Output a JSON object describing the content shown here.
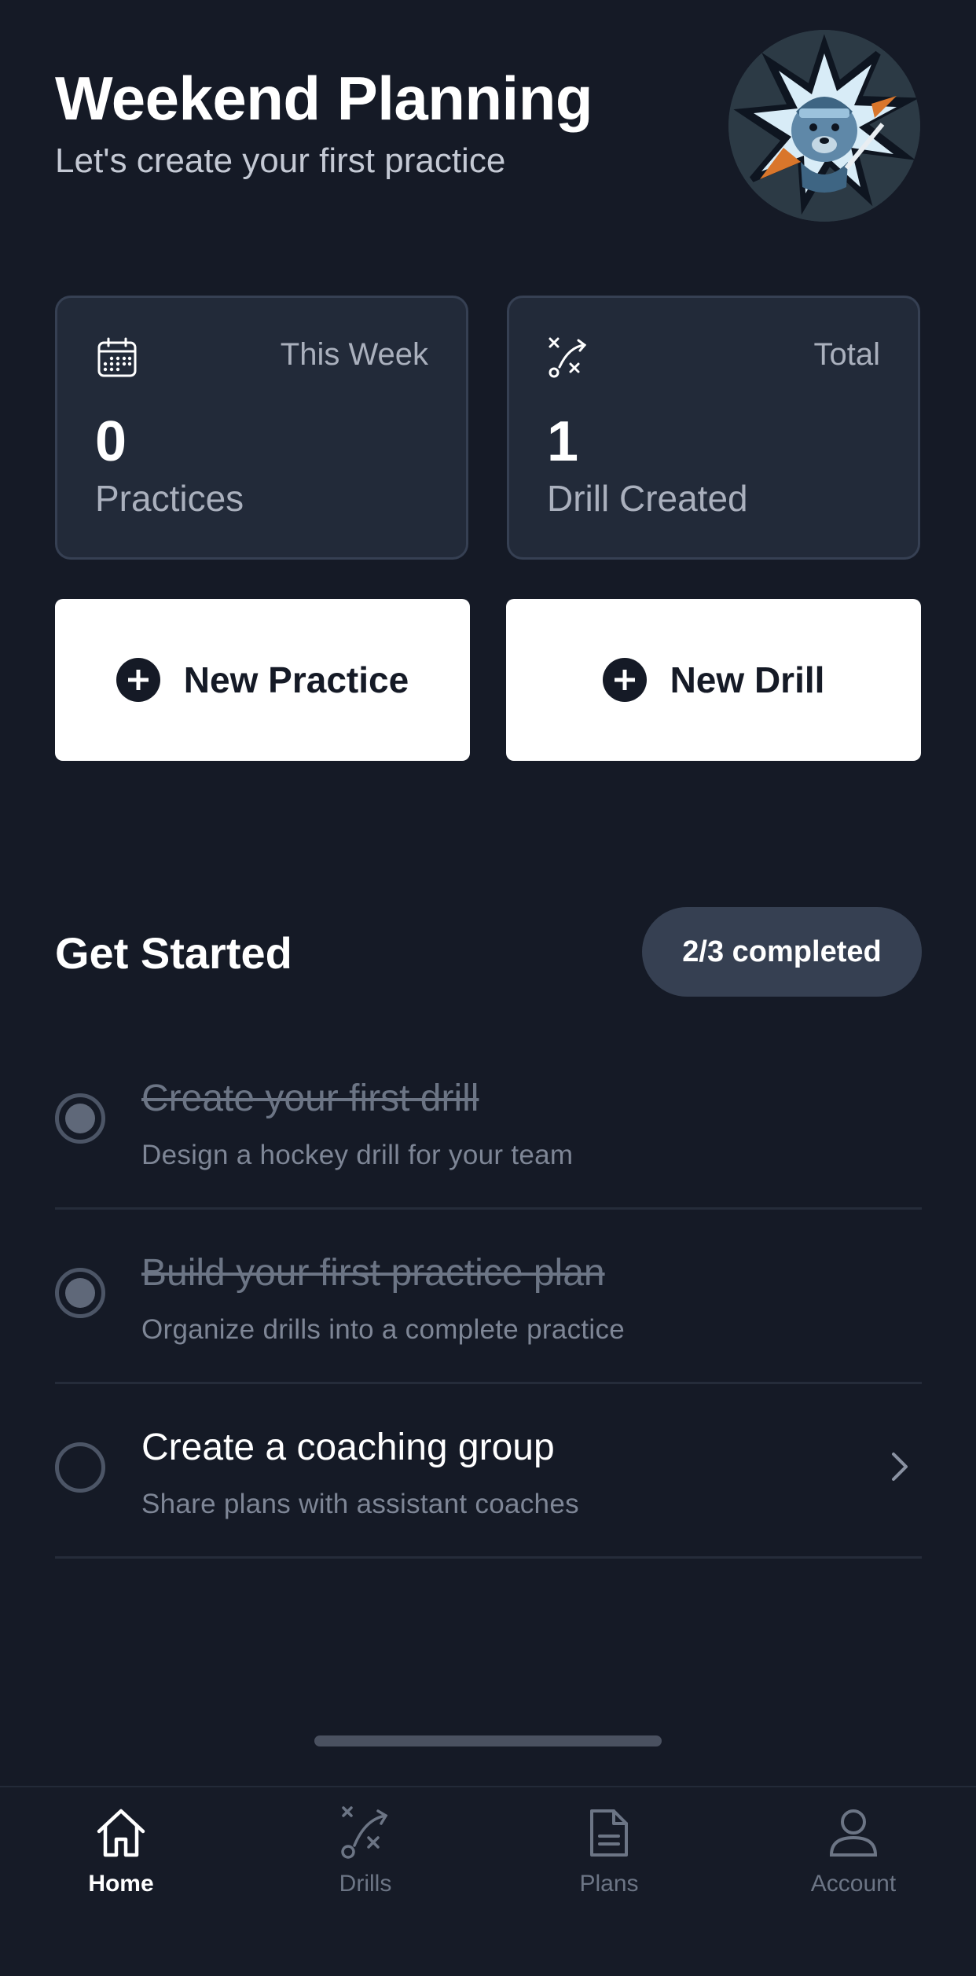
{
  "header": {
    "title": "Weekend Planning",
    "subtitle": "Let's create your first practice",
    "avatar_icon": "bear-team-logo-icon"
  },
  "stats": [
    {
      "icon": "calendar-icon",
      "period": "This Week",
      "value": "0",
      "label": "Practices"
    },
    {
      "icon": "drill-play-icon",
      "period": "Total",
      "value": "1",
      "label": "Drill Created"
    }
  ],
  "actions": {
    "new_practice": "New Practice",
    "new_drill": "New Drill"
  },
  "get_started": {
    "title": "Get Started",
    "progress": "2/3 completed",
    "completed": 2,
    "total": 3,
    "tasks": [
      {
        "title": "Create your first drill",
        "description": "Design a hockey drill for your team",
        "completed": true
      },
      {
        "title": "Build your first practice plan",
        "description": "Organize drills into a complete practice",
        "completed": true
      },
      {
        "title": "Create a coaching group",
        "description": "Share plans with assistant coaches",
        "completed": false
      }
    ]
  },
  "tabbar": {
    "active": "Home",
    "tabs": [
      {
        "label": "Home",
        "icon": "home-icon"
      },
      {
        "label": "Drills",
        "icon": "drill-play-icon"
      },
      {
        "label": "Plans",
        "icon": "document-icon"
      },
      {
        "label": "Account",
        "icon": "person-icon"
      }
    ]
  },
  "colors": {
    "background": "#151a26",
    "card": "#222a39",
    "badge": "#364052",
    "muted_text": "#aab0bd"
  }
}
